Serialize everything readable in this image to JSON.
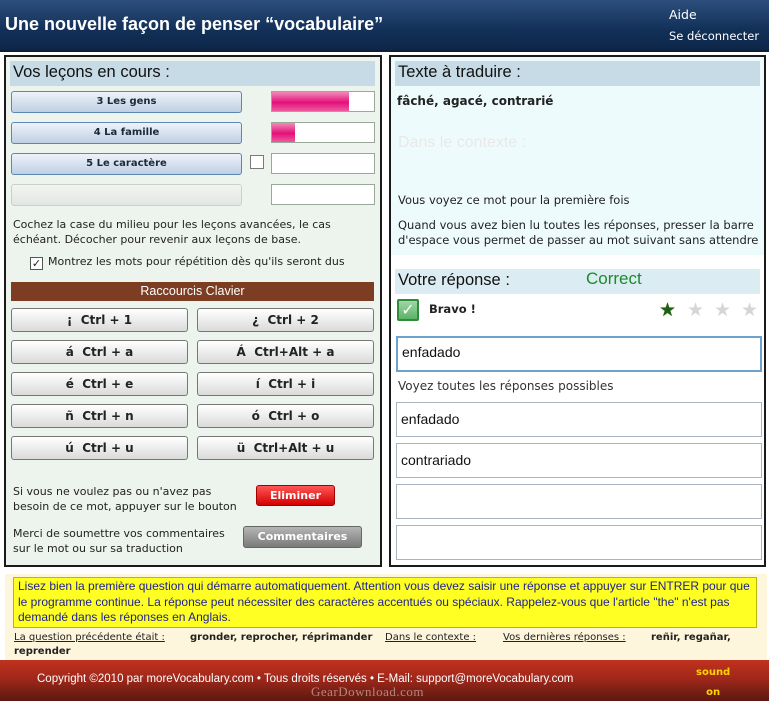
{
  "header": {
    "title": "Une nouvelle façon de penser “vocabulaire”",
    "help_link": "Aide",
    "logout_link": "Se déconnecter"
  },
  "lessons": {
    "heading": "Vos leçons en cours :",
    "items": [
      {
        "label": "3 Les gens",
        "progress": 0.75,
        "advanced_checkbox": false
      },
      {
        "label": "4 La famille",
        "progress": 0.23,
        "advanced_checkbox": false
      },
      {
        "label": "5 Le caractère",
        "progress": 0.0,
        "advanced_checkbox": true
      },
      {
        "label": "",
        "progress": 0.0,
        "advanced_checkbox": false
      }
    ],
    "hint": "Cochez la case du milieu pour les leçons avancées, le cas échéant. Décocher pour revenir aux leçons de base.",
    "repeat_option": {
      "label": "Montrez les mots pour répétition dès qu'ils seront dus",
      "checked": true
    }
  },
  "shortcuts": {
    "title": "Raccourcis Clavier",
    "keys": [
      {
        "char": "¡",
        "combo": "Ctrl + 1"
      },
      {
        "char": "¿",
        "combo": "Ctrl + 2"
      },
      {
        "char": "á",
        "combo": "Ctrl + a"
      },
      {
        "char": "Á",
        "combo": "Ctrl+Alt + a"
      },
      {
        "char": "é",
        "combo": "Ctrl + e"
      },
      {
        "char": "í",
        "combo": "Ctrl + i"
      },
      {
        "char": "ñ",
        "combo": "Ctrl + n"
      },
      {
        "char": "ó",
        "combo": "Ctrl + o"
      },
      {
        "char": "ú",
        "combo": "Ctrl + u"
      },
      {
        "char": "ü",
        "combo": "Ctrl+Alt + u"
      }
    ]
  },
  "actions": {
    "eliminate_text": "Si vous ne voulez pas ou n'avez pas besoin de ce mot, appuyer sur le bouton",
    "eliminate_button": "Eliminer",
    "comment_text": "Merci de soumettre vos commentaires sur le mot ou sur sa traduction",
    "comment_button": "Commentaires"
  },
  "translate": {
    "heading": "Texte à traduire :",
    "word": "fâché, agacé, contrarié",
    "context_label": "Dans le contexte :",
    "first_time": "Vous voyez ce mot pour la première fois",
    "instruction": "Quand vous avez bien lu toutes les réponses, presser la barre d'espace vous permet de passer au mot suivant sans attendre"
  },
  "answer": {
    "heading": "Votre réponse :",
    "status": "Correct",
    "status_color": "#1d8a2a",
    "feedback": "Bravo !",
    "check_icon": "checkmark-icon",
    "rating": {
      "filled": 1,
      "total": 4
    },
    "user_input": "enfadado",
    "see_all_label": "Voyez toutes les réponses possibles",
    "possible": [
      "enfadado",
      "contrariado",
      "",
      ""
    ]
  },
  "instructions": {
    "text": "Lisez bien la première question qui démarre automatiquement. Attention vous devez saisir une réponse et appuyer sur ENTRER pour que le programme continue. La réponse peut nécessiter des caractères accentués ou spéciaux. Rappelez-vous que l'article \"the\" n'est pas demandé dans les réponses en Anglais."
  },
  "history": {
    "previous_label": "La question précédente était :",
    "previous_value": "gronder, reprocher, réprimander",
    "context_label": "Dans le contexte :",
    "recent_label": "Vos dernières réponses :",
    "recent_value_line1": "reñir, regañar,",
    "recent_value_line2": "reprender"
  },
  "footer": {
    "copyright": "Copyright ©2010 par moreVocabulary.com  •  Tous droits réservés •  E-Mail:     support@moreVocabulary.com",
    "sound_label": "sound",
    "sound_state": "on",
    "watermark": "GearDownload.com"
  },
  "colors": {
    "header_bg": "#123058",
    "progress_fill": "#e3107a",
    "shortcut_bar": "#7c3d23",
    "eliminate_button": "#d40000",
    "instructions_bg": "#ffff23",
    "instructions_text": "#1b1f98",
    "footer_bg": "#a0281a",
    "sound_text": "#ffd400"
  }
}
